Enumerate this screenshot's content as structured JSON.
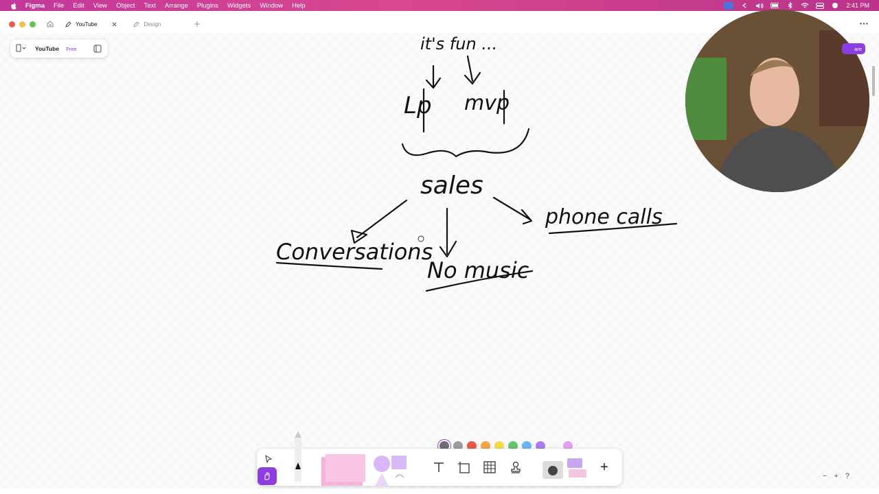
{
  "menubar": {
    "app": "Figma",
    "items": [
      "File",
      "Edit",
      "View",
      "Object",
      "Text",
      "Arrange",
      "Plugins",
      "Widgets",
      "Window",
      "Help"
    ],
    "clock": "2:41 PM"
  },
  "tabs": [
    {
      "label": "YouTube",
      "active": true
    },
    {
      "label": "Design",
      "active": false
    }
  ],
  "file": {
    "name": "YouTube",
    "plan": "Free"
  },
  "share_label": "are",
  "canvas_text": {
    "top": "it's fun ... ",
    "lp": "Lp",
    "mvp": "mvp",
    "sales": "sales",
    "conversations": "Conversations",
    "no_music": "No music",
    "phone_calls": "phone calls"
  },
  "palette_colors": [
    "#6e6e73",
    "#9b9ba0",
    "#e8594b",
    "#f5a34a",
    "#f7d84c",
    "#63c56b",
    "#66b6f0",
    "#a97ef0",
    "#f7f7f7",
    "#e2a0f0"
  ],
  "colors": {
    "accent": "#8c3ee0",
    "menubar": "#c9408f"
  },
  "toolbar": {
    "add_label": "+"
  },
  "zoom": {
    "minus": "−",
    "plus": "+",
    "help": "?"
  }
}
